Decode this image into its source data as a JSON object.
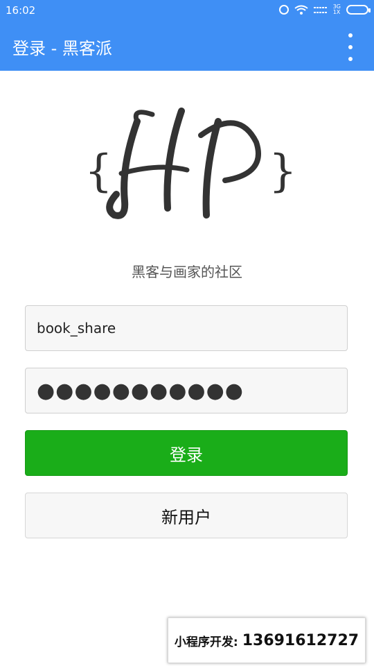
{
  "status_bar": {
    "time": "16:02",
    "network_labels": [
      "3G",
      "1X"
    ],
    "icons": [
      "alarm-icon",
      "wifi-icon",
      "signal-icon",
      "battery-icon"
    ]
  },
  "header": {
    "title": "登录 - 黑客派",
    "menu_icon": "overflow-menu-icon",
    "background_color": "#3f8ff5"
  },
  "logo": {
    "text": "{HP}"
  },
  "slogan": "黑客与画家的社区",
  "form": {
    "username_value": "book_share",
    "password_mask": "●●●●●●●●●●●"
  },
  "buttons": {
    "login_label": "登录",
    "login_color": "#1aad19",
    "new_user_label": "新用户"
  },
  "watermark": {
    "label": "小程序开发:",
    "phone": "13691612727"
  }
}
